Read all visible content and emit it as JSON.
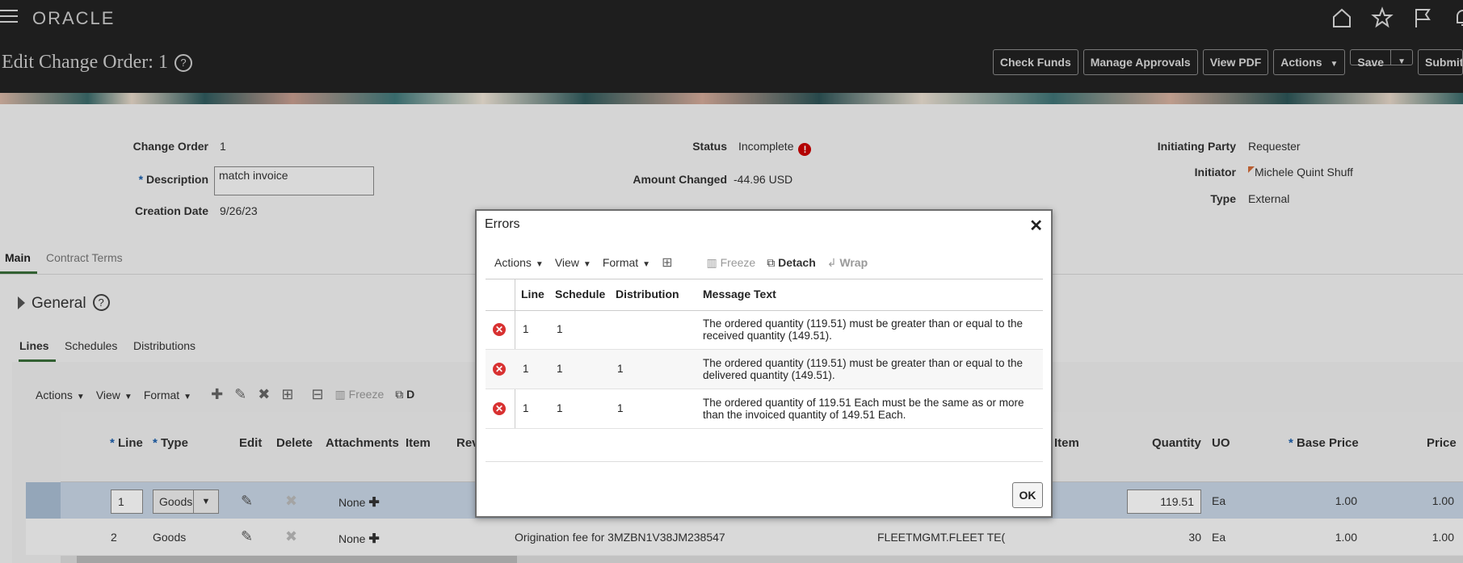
{
  "app": {
    "logo": "ORACLE"
  },
  "page": {
    "title": "Edit Change Order: 1",
    "help": "?"
  },
  "toolbar": {
    "check_funds": "Check Funds",
    "manage_approvals": "Manage Approvals",
    "view_pdf": "View PDF",
    "actions": "Actions",
    "save": "Save",
    "submit": "Submit"
  },
  "header": {
    "change_order_label": "Change Order",
    "change_order_value": "1",
    "description_label": "Description",
    "description_value": "match invoice",
    "creation_date_label": "Creation Date",
    "creation_date_value": "9/26/23",
    "status_label": "Status",
    "status_value": "Incomplete",
    "amount_changed_label": "Amount Changed",
    "amount_changed_value": "-44.96",
    "amount_changed_currency": "USD",
    "initiating_party_label": "Initiating Party",
    "initiating_party_value": "Requester",
    "initiator_label": "Initiator",
    "initiator_value": "Michele Quint Shuff",
    "type_label": "Type",
    "type_value": "External"
  },
  "tabs": {
    "main": "Main",
    "contract_terms": "Contract Terms"
  },
  "general": {
    "label": "General"
  },
  "subtabs": {
    "lines": "Lines",
    "schedules": "Schedules",
    "distributions": "Distributions"
  },
  "lines_toolbar": {
    "actions": "Actions",
    "view": "View",
    "format": "Format",
    "freeze": "Freeze",
    "detach_partial": "D"
  },
  "lines_columns": {
    "line": "Line",
    "type": "Type",
    "edit": "Edit",
    "delete": "Delete",
    "attachments": "Attachments",
    "item": "Item",
    "rev": "Rev",
    "supplier_item": "r Item",
    "quantity": "Quantity",
    "uom": "UO",
    "base_price": "Base Price",
    "price": "Price"
  },
  "lines_rows": [
    {
      "line": "1",
      "type": "Goods",
      "attachments": "None",
      "description": "",
      "supplier_item": "",
      "quantity": "119.51",
      "uom": "Ea",
      "base_price": "1.00",
      "price": "1.00"
    },
    {
      "line": "2",
      "type": "Goods",
      "attachments": "None",
      "description": "Origination fee for 3MZBN1V38JM238547",
      "supplier_item": "FLEETMGMT.FLEET TE(",
      "quantity": "30",
      "uom": "Ea",
      "base_price": "1.00",
      "price": "1.00"
    }
  ],
  "errors_dialog": {
    "title": "Errors",
    "toolbar": {
      "actions": "Actions",
      "view": "View",
      "format": "Format",
      "freeze": "Freeze",
      "detach": "Detach",
      "wrap": "Wrap"
    },
    "columns": {
      "line": "Line",
      "schedule": "Schedule",
      "distribution": "Distribution",
      "message": "Message Text"
    },
    "rows": [
      {
        "line": "1",
        "schedule": "1",
        "distribution": "",
        "message": "The ordered quantity (119.51) must be greater than or equal to the received quantity (149.51)."
      },
      {
        "line": "1",
        "schedule": "1",
        "distribution": "1",
        "message": "The ordered quantity (119.51) must be greater than or equal to the delivered quantity (149.51)."
      },
      {
        "line": "1",
        "schedule": "1",
        "distribution": "1",
        "message": "The ordered quantity of 119.51 Each must be the same as or more than the invoiced quantity of 149.51 Each."
      }
    ],
    "ok": "OK"
  }
}
